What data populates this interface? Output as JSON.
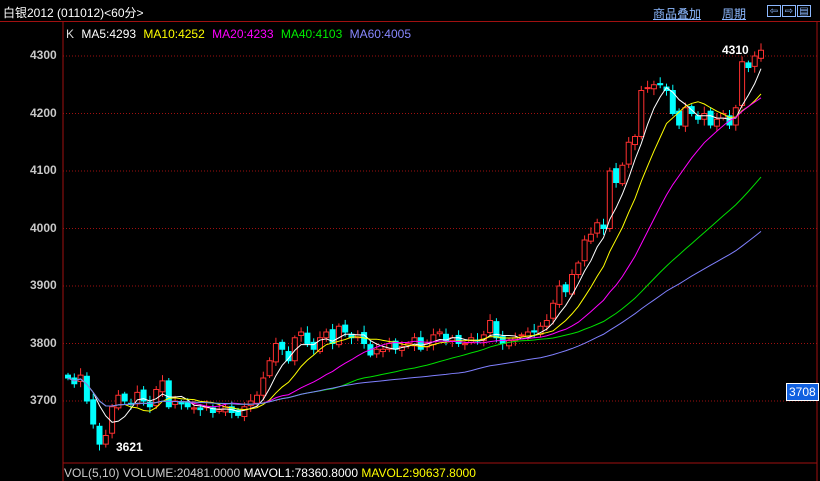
{
  "header": {
    "title": "白银2012 (011012)<60分>",
    "overlay_label": "商品叠加",
    "period_label": "周期",
    "nav_icons": [
      "arrow-left-icon",
      "arrow-right-icon",
      "panel-icon"
    ]
  },
  "legend": {
    "k": "K",
    "ma5": "MA5:4293",
    "ma10": "MA10:4252",
    "ma20": "MA20:4233",
    "ma40": "MA40:4103",
    "ma60": "MA60:4005"
  },
  "colors": {
    "up": "#ff3030",
    "down": "#00ffff",
    "ma5": "#ffffff",
    "ma10": "#ffff00",
    "ma20": "#ff00ff",
    "ma40": "#00e000",
    "ma60": "#8080ff",
    "grid": "#a01010"
  },
  "y_axis": [
    "4300",
    "4200",
    "4100",
    "4000",
    "3900",
    "3800",
    "3700"
  ],
  "last_price": "3708",
  "annotations": {
    "high": "4310",
    "low": "3621"
  },
  "volume": {
    "label": "VOL(5,10)",
    "volume": "VOLUME:20481.0000",
    "mavol1": "MAVOL1:78360.8000",
    "mavol2": "MAVOL2:90637.8000"
  },
  "chart_data": {
    "type": "candlestick",
    "ylim": [
      3580,
      4340
    ],
    "closes": [
      3740,
      3730,
      3745,
      3700,
      3660,
      3625,
      3640,
      3690,
      3710,
      3700,
      3695,
      3715,
      3700,
      3690,
      3720,
      3735,
      3690,
      3700,
      3695,
      3690,
      3688,
      3685,
      3690,
      3680,
      3685,
      3690,
      3680,
      3675,
      3690,
      3700,
      3710,
      3740,
      3770,
      3800,
      3790,
      3770,
      3810,
      3820,
      3800,
      3790,
      3810,
      3820,
      3800,
      3830,
      3820,
      3810,
      3815,
      3800,
      3780,
      3790,
      3790,
      3800,
      3790,
      3795,
      3800,
      3810,
      3790,
      3800,
      3815,
      3820,
      3805,
      3810,
      3800,
      3800,
      3810,
      3805,
      3815,
      3840,
      3810,
      3800,
      3805,
      3810,
      3815,
      3820,
      3820,
      3830,
      3840,
      3870,
      3900,
      3890,
      3920,
      3940,
      3980,
      3990,
      4010,
      4000,
      4100,
      4080,
      4110,
      4150,
      4160,
      4240,
      4245,
      4250,
      4250,
      4240,
      4200,
      4180,
      4210,
      4200,
      4190,
      4200,
      4180,
      4190,
      4200,
      4180,
      4210,
      4290,
      4280,
      4300,
      4310
    ]
  }
}
